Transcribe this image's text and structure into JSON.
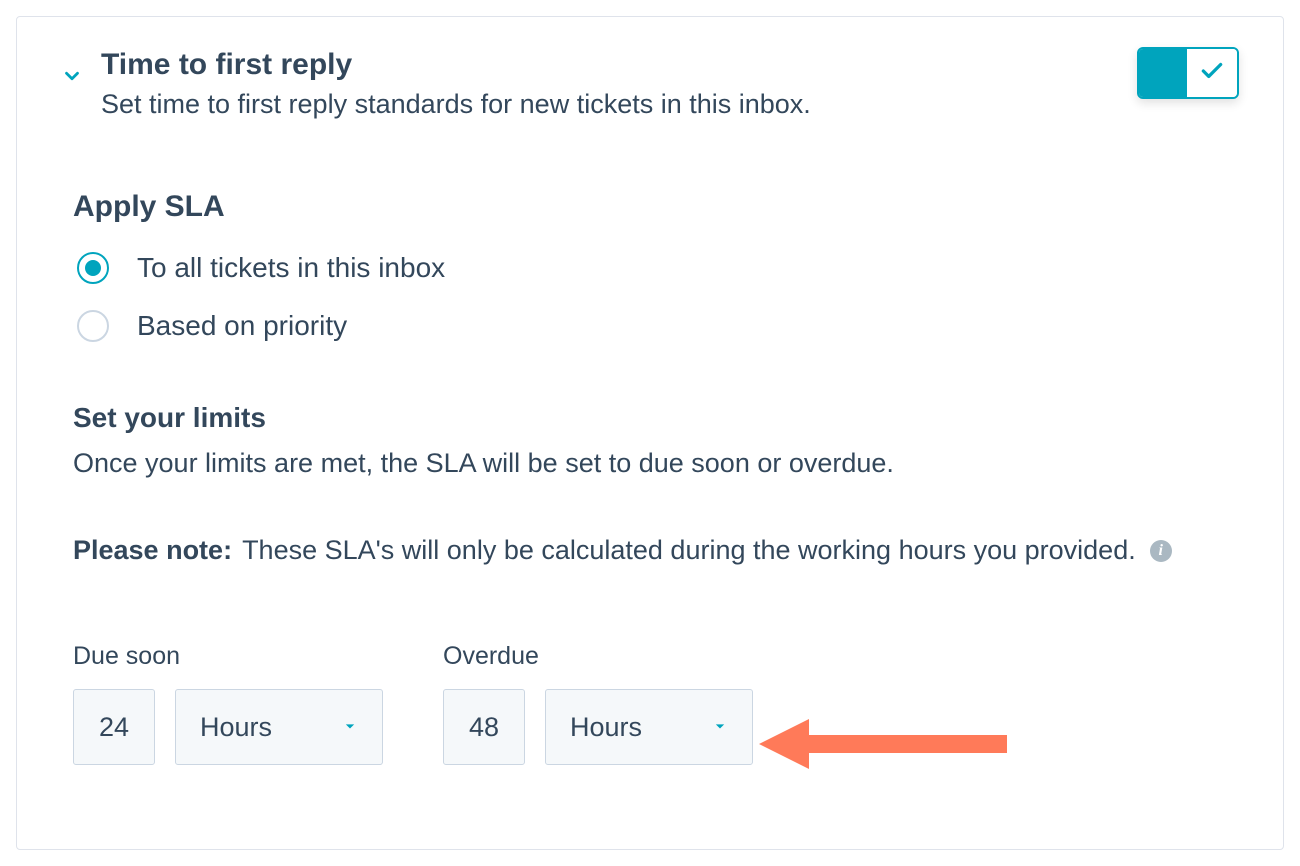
{
  "header": {
    "title": "Time to first reply",
    "subtitle": "Set time to first reply standards for new tickets in this inbox.",
    "toggle_on": true
  },
  "apply_sla": {
    "heading": "Apply SLA",
    "options": [
      {
        "label": "To all tickets in this inbox",
        "selected": true
      },
      {
        "label": "Based on priority",
        "selected": false
      }
    ]
  },
  "limits": {
    "heading": "Set your limits",
    "description": "Once your limits are met, the SLA will be set to due soon or overdue.",
    "note_bold": "Please note:",
    "note_rest": "These SLA's will only be calculated during the working hours you provided.",
    "due_soon": {
      "label": "Due soon",
      "value": "24",
      "unit": "Hours"
    },
    "overdue": {
      "label": "Overdue",
      "value": "48",
      "unit": "Hours"
    }
  }
}
